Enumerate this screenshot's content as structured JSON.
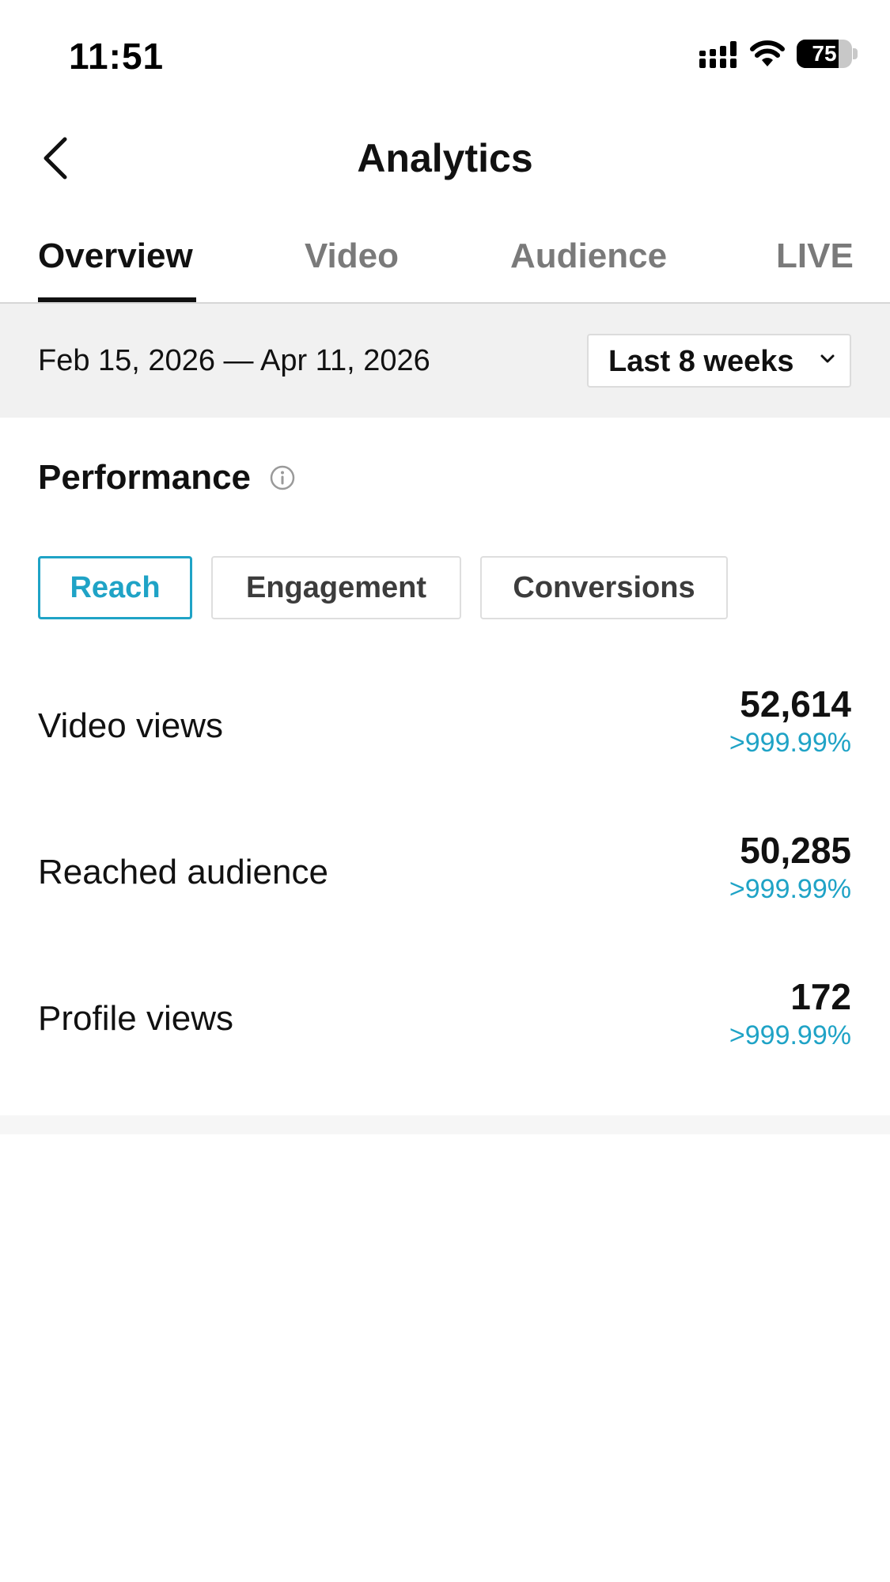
{
  "status_bar": {
    "time": "11:51",
    "battery_level": "75",
    "icons": [
      "signal-icon",
      "wifi-icon",
      "battery-icon"
    ]
  },
  "header": {
    "title": "Analytics",
    "back_icon": "chevron-left-icon"
  },
  "tabs": [
    {
      "label": "Overview",
      "active": true
    },
    {
      "label": "Video",
      "active": false
    },
    {
      "label": "Audience",
      "active": false
    },
    {
      "label": "LIVE",
      "active": false
    }
  ],
  "date_bar": {
    "range": "Feb 15, 2026 — Apr 11, 2026",
    "period": "Last 8 weeks"
  },
  "performance": {
    "title": "Performance",
    "info_icon": "info-icon",
    "filters": [
      {
        "label": "Reach",
        "active": true
      },
      {
        "label": "Engagement",
        "active": false
      },
      {
        "label": "Conversions",
        "active": false
      }
    ],
    "metrics": [
      {
        "label": "Video views",
        "value": "52,614",
        "change": ">999.99%"
      },
      {
        "label": "Reached audience",
        "value": "50,285",
        "change": ">999.99%"
      },
      {
        "label": "Profile views",
        "value": "172",
        "change": ">999.99%"
      }
    ]
  },
  "colors": {
    "accent": "#1fa3c6",
    "text": "#111111",
    "muted_tab": "#7a7a7a",
    "date_bar_bg": "#f1f1f1"
  }
}
